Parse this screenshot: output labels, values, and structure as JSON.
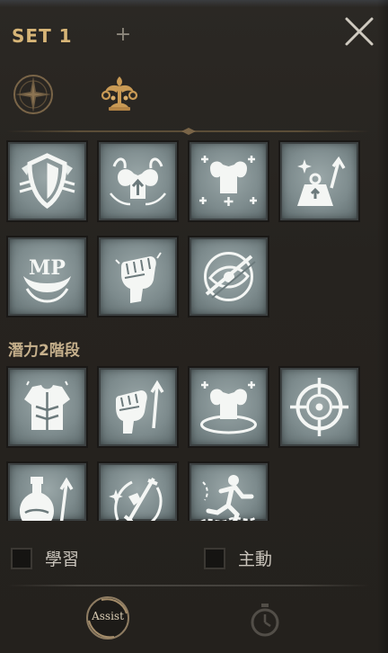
{
  "header": {
    "set_label": "SET 1",
    "add_symbol": "+",
    "close_icon": "close-x-icon"
  },
  "category_tabs": [
    {
      "icon": "compass-star-icon",
      "selected": false
    },
    {
      "icon": "golden-tree-emblem-icon",
      "selected": true
    }
  ],
  "skills_group_1": [
    {
      "icon": "shield-wings-icon"
    },
    {
      "icon": "muscle-claw-up-icon"
    },
    {
      "icon": "muscle-sparkle-icon"
    },
    {
      "icon": "weight-arrow-up-icon"
    },
    {
      "icon": "mp-jaw-icon"
    },
    {
      "icon": "fist-icon"
    },
    {
      "icon": "eye-slash-icon"
    }
  ],
  "section_label": "潛力2階段",
  "skills_group_2": [
    {
      "icon": "armor-vest-icon"
    },
    {
      "icon": "fist-arrow-up-icon"
    },
    {
      "icon": "muscle-ring-icon"
    },
    {
      "icon": "crosshair-target-icon"
    },
    {
      "icon": "potion-arrow-icon"
    },
    {
      "icon": "sword-shield-cycle-icon"
    },
    {
      "icon": "runner-chain-icon"
    }
  ],
  "options": {
    "learn_label": "學習",
    "learn_checked": false,
    "active_label": "主動",
    "active_checked": false
  },
  "bottom_bar": {
    "assist_label": "Assist",
    "timer_icon": "stopwatch-icon"
  },
  "colors": {
    "title_gold": "#d7b577",
    "skill_tile": "#8b9799",
    "icon_white": "#f4f6f4",
    "background": "#26231f"
  }
}
